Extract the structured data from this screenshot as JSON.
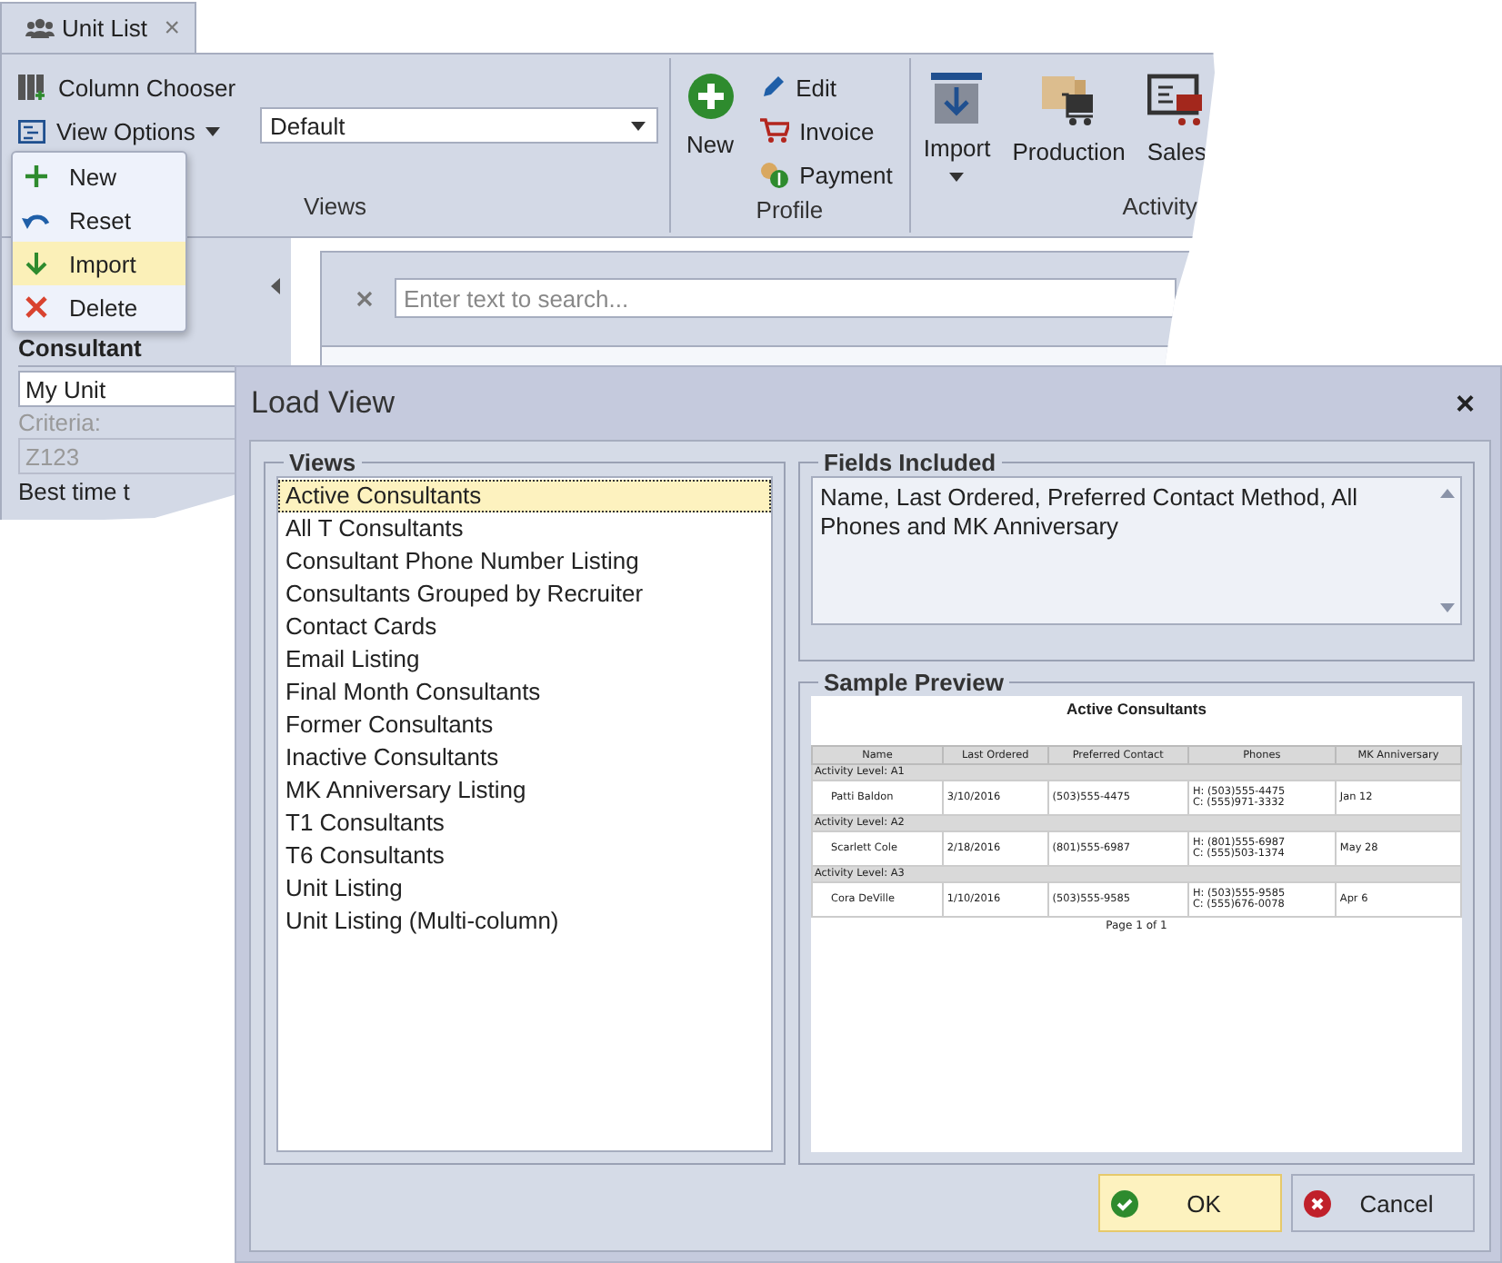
{
  "tab": {
    "label": "Unit List",
    "close": "×"
  },
  "ribbon": {
    "groups": [
      {
        "kind": "views",
        "label": "Views",
        "column_chooser": "Column Chooser",
        "view_options": "View Options",
        "view_select": "Default"
      },
      {
        "kind": "profile",
        "label": "Profile",
        "new": "New",
        "actions": [
          {
            "kind": "edit",
            "label": "Edit"
          },
          {
            "kind": "invoice",
            "label": "Invoice"
          },
          {
            "kind": "payment",
            "label": "Payment"
          }
        ]
      },
      {
        "kind": "activity",
        "label": "Activity",
        "buttons": [
          {
            "kind": "import",
            "label": "Import",
            "dropdown": true
          },
          {
            "kind": "production",
            "label": "Production",
            "dropdown": false
          },
          {
            "kind": "sales",
            "label": "Sales",
            "dropdown": false
          }
        ]
      }
    ]
  },
  "view_options_menu": [
    {
      "kind": "add",
      "label": "New",
      "selected": false
    },
    {
      "kind": "undo",
      "label": "Reset",
      "selected": false
    },
    {
      "kind": "download",
      "label": "Import",
      "selected": true
    },
    {
      "kind": "remove",
      "label": "Delete",
      "selected": false
    }
  ],
  "filter_panel": {
    "title": "Consultant",
    "unit": "My Unit",
    "criteria_label": "Criteria:",
    "criteria": "Z123",
    "best_time_label": "Best time t"
  },
  "search": {
    "placeholder": "Enter text to search..."
  },
  "dialog": {
    "title": "Load View",
    "close": "×",
    "views_label": "Views",
    "views": [
      {
        "label": "Active Consultants",
        "selected": true
      },
      {
        "label": "All T Consultants",
        "selected": false
      },
      {
        "label": "Consultant Phone Number Listing",
        "selected": false
      },
      {
        "label": "Consultants Grouped by Recruiter",
        "selected": false
      },
      {
        "label": "Contact Cards",
        "selected": false
      },
      {
        "label": "Email Listing",
        "selected": false
      },
      {
        "label": "Final Month Consultants",
        "selected": false
      },
      {
        "label": "Former Consultants",
        "selected": false
      },
      {
        "label": "Inactive Consultants",
        "selected": false
      },
      {
        "label": "MK Anniversary Listing",
        "selected": false
      },
      {
        "label": "T1 Consultants",
        "selected": false
      },
      {
        "label": "T6 Consultants",
        "selected": false
      },
      {
        "label": "Unit Listing",
        "selected": false
      },
      {
        "label": "Unit Listing (Multi-column)",
        "selected": false
      }
    ],
    "fields_label": "Fields Included",
    "fields": "Name, Last Ordered, Preferred Contact Method, All Phones and MK Anniversary",
    "preview_label": "Sample Preview",
    "preview": {
      "title": "Active Consultants",
      "columns": [
        "Name",
        "Last Ordered",
        "Preferred Contact",
        "Phones",
        "MK Anniversary"
      ],
      "groups": [
        {
          "label": "Activity Level: A1",
          "rows": [
            {
              "name": "Patti Baldon",
              "last_ordered": "3/10/2016",
              "contact": "(503)555-4475",
              "phones": [
                "H: (503)555-4475",
                "C: (555)971-3332"
              ],
              "anniversary": "Jan 12"
            }
          ]
        },
        {
          "label": "Activity Level: A2",
          "rows": [
            {
              "name": "Scarlett Cole",
              "last_ordered": "2/18/2016",
              "contact": "(801)555-6987",
              "phones": [
                "H: (801)555-6987",
                "C: (555)503-1374"
              ],
              "anniversary": "May 28"
            }
          ]
        },
        {
          "label": "Activity Level: A3",
          "rows": [
            {
              "name": "Cora DeVille",
              "last_ordered": "1/10/2016",
              "contact": "(503)555-9585",
              "phones": [
                "H: (503)555-9585",
                "C: (555)676-0078"
              ],
              "anniversary": "Apr 6"
            }
          ]
        }
      ],
      "footer": "Page  1 of 1"
    },
    "buttons": [
      {
        "kind": "ok",
        "label": "OK",
        "selected": true
      },
      {
        "kind": "cancel",
        "label": "Cancel",
        "selected": false
      }
    ]
  }
}
